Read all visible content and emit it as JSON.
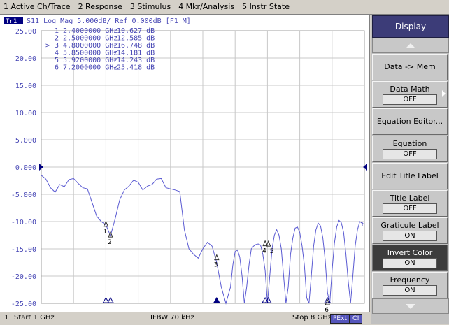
{
  "menu": [
    {
      "label": "1 Active Ch/Trace"
    },
    {
      "label": "2 Response"
    },
    {
      "label": "3 Stimulus"
    },
    {
      "label": "4 Mkr/Analysis"
    },
    {
      "label": "5 Instr State"
    }
  ],
  "trace_header": {
    "tag": "Tr1",
    "text": "S11  Log Mag 5.000dB/ Ref 0.000dB [F1 M]"
  },
  "markers_table": [
    {
      "id": "1",
      "active": false,
      "freq": "2.4000000 GHz",
      "value": "-10.627 dB"
    },
    {
      "id": "2",
      "active": false,
      "freq": "2.5000000 GHz",
      "value": "-12.585 dB"
    },
    {
      "id": "3",
      "active": true,
      "freq": "4.8000000 GHz",
      "value": "-16.748 dB"
    },
    {
      "id": "4",
      "active": false,
      "freq": "5.8500000 GHz",
      "value": "-14.181 dB"
    },
    {
      "id": "5",
      "active": false,
      "freq": "5.9200000 GHz",
      "value": "-14.243 dB"
    },
    {
      "id": "6",
      "active": false,
      "freq": "7.2000000 GHz",
      "value": "-25.418 dB"
    }
  ],
  "status": {
    "channel": "1",
    "start": "Start 1 GHz",
    "ifbw": "IFBW 70 kHz",
    "stop": "Stop 8 GHz",
    "badge1": "PExt",
    "badge2": "C!"
  },
  "softkeys": {
    "header": "Display",
    "items": [
      {
        "label": "Data -> Mem"
      },
      {
        "label": "Data Math",
        "value": "OFF",
        "submenu": true
      },
      {
        "label": "Equation Editor..."
      },
      {
        "label": "Equation",
        "value": "OFF"
      },
      {
        "label": "Edit Title Label"
      },
      {
        "label": "Title Label",
        "value": "OFF"
      },
      {
        "label": "Graticule Label",
        "value": "ON"
      },
      {
        "label": "Invert Color",
        "value": "ON",
        "highlight": true
      },
      {
        "label": "Frequency",
        "value": "ON"
      }
    ]
  },
  "colors": {
    "trace": "#5a5ad2",
    "grid": "#c8c8c8",
    "text": "#4646b4",
    "ref_arrow": "#000080"
  },
  "chart_data": {
    "type": "line",
    "ylabel": "",
    "xlabel": "",
    "xlim": [
      1,
      8
    ],
    "ylim": [
      -25,
      25
    ],
    "y_ticks": [
      "25.00",
      "20.00",
      "15.00",
      "10.00",
      "5.000",
      "0.000",
      "-5.000",
      "-10.00",
      "-15.00",
      "-20.00",
      "-25.00"
    ],
    "reference_level": 0,
    "right_end_label": "1",
    "series": [
      {
        "name": "S11",
        "x": [
          1.0,
          1.1,
          1.2,
          1.3,
          1.4,
          1.5,
          1.6,
          1.7,
          1.8,
          1.9,
          2.0,
          2.1,
          2.2,
          2.3,
          2.4,
          2.5,
          2.6,
          2.7,
          2.8,
          2.9,
          3.0,
          3.1,
          3.2,
          3.3,
          3.4,
          3.5,
          3.6,
          3.7,
          3.8,
          3.9,
          4.0,
          4.1,
          4.2,
          4.3,
          4.4,
          4.5,
          4.6,
          4.7,
          4.8,
          4.9,
          5.0,
          5.1,
          5.15,
          5.2,
          5.25,
          5.3,
          5.35,
          5.4,
          5.45,
          5.5,
          5.55,
          5.6,
          5.65,
          5.7,
          5.75,
          5.8,
          5.85,
          5.9,
          5.95,
          6.0,
          6.05,
          6.1,
          6.15,
          6.2,
          6.25,
          6.3,
          6.35,
          6.4,
          6.45,
          6.5,
          6.55,
          6.6,
          6.65,
          6.7,
          6.75,
          6.8,
          6.85,
          6.9,
          6.95,
          7.0,
          7.05,
          7.1,
          7.15,
          7.2,
          7.25,
          7.3,
          7.35,
          7.4,
          7.45,
          7.5,
          7.55,
          7.6,
          7.65,
          7.7,
          7.75,
          7.8,
          7.85,
          7.9,
          7.95,
          8.0
        ],
        "y": [
          -1.5,
          -2.2,
          -3.8,
          -4.6,
          -3.2,
          -3.6,
          -2.3,
          -2.1,
          -3.0,
          -3.8,
          -4.0,
          -6.5,
          -9.0,
          -10.0,
          -10.6,
          -12.6,
          -9.5,
          -6.0,
          -4.2,
          -3.5,
          -2.4,
          -2.8,
          -4.2,
          -3.5,
          -3.2,
          -2.2,
          -2.1,
          -3.8,
          -4.0,
          -4.2,
          -4.5,
          -11.5,
          -15.0,
          -16.0,
          -16.7,
          -15.0,
          -13.8,
          -14.5,
          -17.5,
          -22.0,
          -25.0,
          -22.0,
          -18.0,
          -15.5,
          -15.2,
          -16.5,
          -20.0,
          -25.0,
          -22.0,
          -18.0,
          -15.0,
          -14.5,
          -14.2,
          -14.1,
          -14.3,
          -16.0,
          -19.0,
          -25.0,
          -20.0,
          -15.0,
          -12.5,
          -11.5,
          -12.5,
          -15.0,
          -20.0,
          -25.0,
          -22.0,
          -16.0,
          -13.0,
          -11.2,
          -11.0,
          -12.0,
          -14.5,
          -18.0,
          -24.0,
          -25.0,
          -20.0,
          -14.5,
          -11.5,
          -10.3,
          -10.8,
          -13.0,
          -17.0,
          -23.0,
          -25.0,
          -19.0,
          -14.0,
          -11.0,
          -9.8,
          -10.2,
          -12.0,
          -16.0,
          -21.0,
          -25.0,
          -20.0,
          -14.5,
          -11.5,
          -10.0,
          -10.3,
          -10.5
        ]
      }
    ],
    "markers": [
      {
        "id": "1",
        "x": 2.4,
        "y": -10.627
      },
      {
        "id": "2",
        "x": 2.5,
        "y": -12.585
      },
      {
        "id": "3",
        "x": 4.8,
        "y": -16.748
      },
      {
        "id": "4",
        "x": 5.85,
        "y": -14.181
      },
      {
        "id": "5",
        "x": 5.92,
        "y": -14.243
      },
      {
        "id": "6",
        "x": 7.2,
        "y": -25.418
      }
    ]
  }
}
